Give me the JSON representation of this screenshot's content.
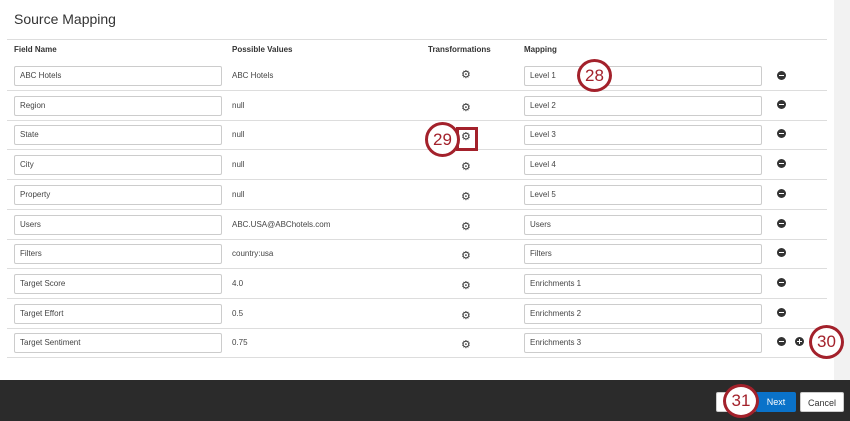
{
  "title": "Source Mapping",
  "headers": {
    "field_name": "Field Name",
    "possible_values": "Possible Values",
    "transformations": "Transformations",
    "mapping": "Mapping"
  },
  "rows": [
    {
      "field": "ABC Hotels",
      "value": "ABC Hotels",
      "mapping": "Level 1"
    },
    {
      "field": "Region",
      "value": "null",
      "mapping": "Level 2"
    },
    {
      "field": "State",
      "value": "null",
      "mapping": "Level 3"
    },
    {
      "field": "City",
      "value": "null",
      "mapping": "Level 4"
    },
    {
      "field": "Property",
      "value": "null",
      "mapping": "Level 5"
    },
    {
      "field": "Users",
      "value": "ABC.USA@ABChotels.com",
      "mapping": "Users"
    },
    {
      "field": "Filters",
      "value": "country:usa",
      "mapping": "Filters"
    },
    {
      "field": "Target Score",
      "value": "4.0",
      "mapping": "Enrichments 1"
    },
    {
      "field": "Target Effort",
      "value": "0.5",
      "mapping": "Enrichments 2"
    },
    {
      "field": "Target Sentiment",
      "value": "0.75",
      "mapping": "Enrichments 3"
    }
  ],
  "footer": {
    "next": "Next",
    "cancel": "Cancel"
  },
  "annotations": {
    "a28": "28",
    "a29": "29",
    "a30": "30",
    "a31": "31"
  },
  "colors": {
    "accent": "#0a72c9",
    "annotation": "#a3212b",
    "footer_bg": "#2b2b2b"
  }
}
